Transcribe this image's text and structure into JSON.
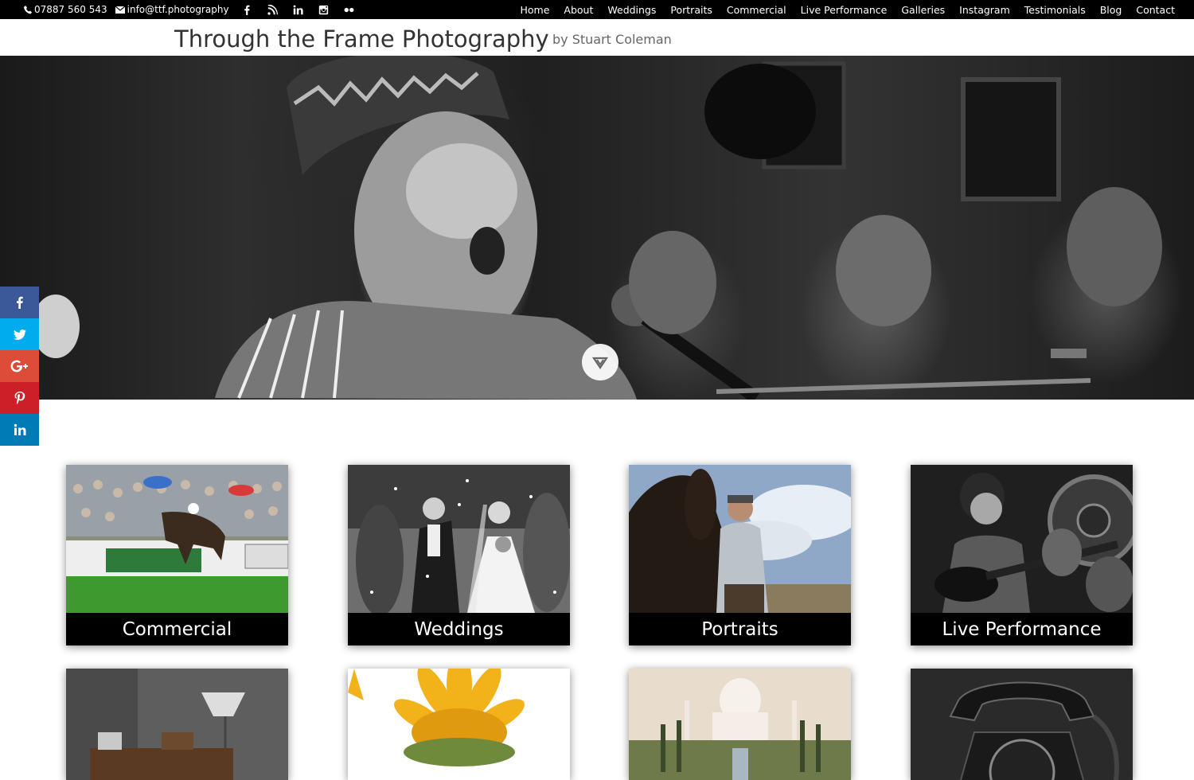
{
  "topbar": {
    "phone": "07887 560 543",
    "email": "info@ttf.photography",
    "social": [
      "facebook-icon",
      "rss-icon",
      "linkedin-icon",
      "instagram-icon",
      "flickr-icon"
    ],
    "nav": [
      "Home",
      "About",
      "Weddings",
      "Portraits",
      "Commercial",
      "Live Performance",
      "Galleries",
      "Instagram",
      "Testimonials",
      "Blog",
      "Contact"
    ]
  },
  "header": {
    "title": "Through the Frame Photography",
    "tagline": "by Stuart Coleman"
  },
  "share": [
    "facebook-icon",
    "twitter-icon",
    "google-plus-icon",
    "pinterest-icon",
    "linkedin-icon"
  ],
  "gallery": {
    "row1": [
      "Commercial",
      "Weddings",
      "Portraits",
      "Live Performance"
    ]
  },
  "colors": {
    "facebook": "#3b5998",
    "twitter": "#00aced",
    "google_plus": "#dd4b39",
    "pinterest": "#cb2027",
    "linkedin": "#007bb6"
  }
}
